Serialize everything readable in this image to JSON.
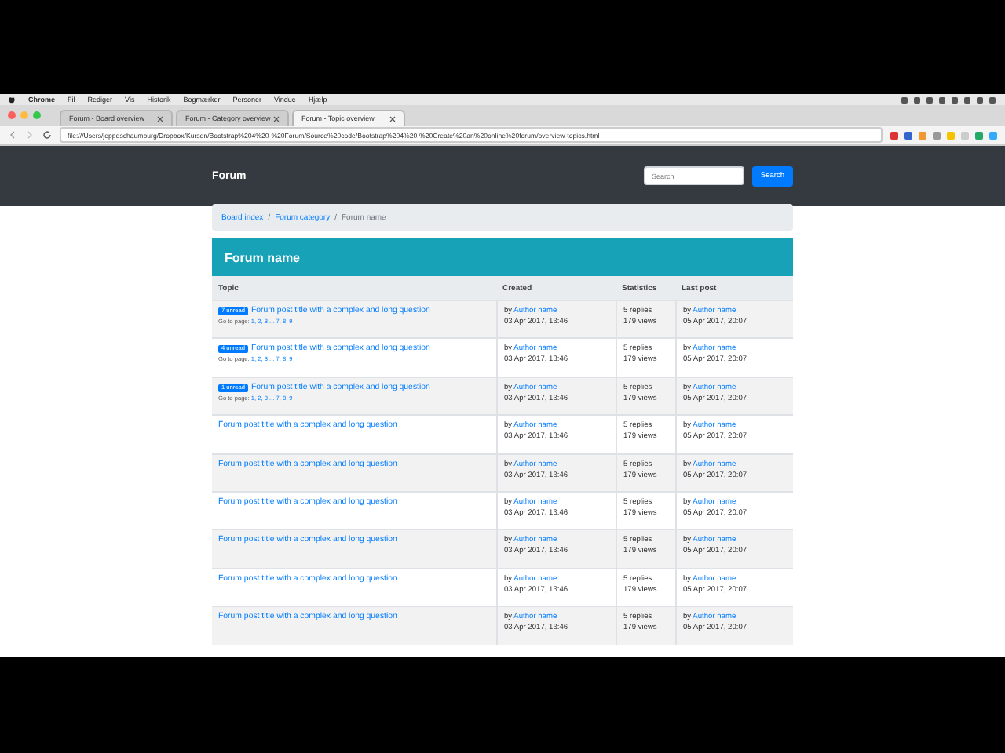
{
  "menu_bar": {
    "items": [
      "Chrome",
      "Fil",
      "Rediger",
      "Vis",
      "Historik",
      "Bogmærker",
      "Personer",
      "Vindue",
      "Hjælp"
    ]
  },
  "tabs": [
    {
      "label": "Forum - Board overview",
      "selected": false
    },
    {
      "label": "Forum - Category overview",
      "selected": false
    },
    {
      "label": "Forum - Topic overview",
      "selected": true
    }
  ],
  "address_bar": {
    "value": "file:///Users/jeppeschaumburg/Dropbox/Kursen/Bootstrap%204%20-%20Forum/Source%20code/Bootstrap%204%20-%20Create%20an%20online%20forum/overview-topics.html"
  },
  "navbar": {
    "brand": "Forum",
    "search": {
      "placeholder": "Search"
    },
    "search_button": "Search"
  },
  "breadcrumb_separator": "/",
  "breadcrumb": [
    {
      "label": "Board index",
      "kind": "link"
    },
    {
      "label": "Forum category",
      "kind": "link"
    },
    {
      "label": "Forum name",
      "kind": "current"
    }
  ],
  "forum": {
    "title": "Forum name",
    "columns": [
      "Topic",
      "Created",
      "Statistics",
      "Last post"
    ],
    "rows": [
      {
        "badge": "7 unread",
        "title": "Forum post title with a complex and long question",
        "pages_label": "Go to page:",
        "pages": "1, 2, 3 ... 7, 8, 9",
        "by": "by",
        "author": "Author name",
        "created": "03 Apr 2017, 13:46",
        "replies": "5 replies",
        "views": "179 views",
        "last_by": "by",
        "last_author": "Author name",
        "last_date": "05 Apr 2017, 20:07"
      },
      {
        "badge": "4 unread",
        "title": "Forum post title with a complex and long question",
        "pages_label": "Go to page:",
        "pages": "1, 2, 3 ... 7, 8, 9",
        "by": "by",
        "author": "Author name",
        "created": "03 Apr 2017, 13:46",
        "replies": "5 replies",
        "views": "179 views",
        "last_by": "by",
        "last_author": "Author name",
        "last_date": "05 Apr 2017, 20:07"
      },
      {
        "badge": "1 unread",
        "title": "Forum post title with a complex and long question",
        "pages_label": "Go to page:",
        "pages": "1, 2, 3 ... 7, 8, 9",
        "by": "by",
        "author": "Author name",
        "created": "03 Apr 2017, 13:46",
        "replies": "5 replies",
        "views": "179 views",
        "last_by": "by",
        "last_author": "Author name",
        "last_date": "05 Apr 2017, 20:07"
      },
      {
        "title": "Forum post title with a complex and long question",
        "by": "by",
        "author": "Author name",
        "created": "03 Apr 2017, 13:46",
        "replies": "5 replies",
        "views": "179 views",
        "last_by": "by",
        "last_author": "Author name",
        "last_date": "05 Apr 2017, 20:07"
      },
      {
        "title": "Forum post title with a complex and long question",
        "by": "by",
        "author": "Author name",
        "created": "03 Apr 2017, 13:46",
        "replies": "5 replies",
        "views": "179 views",
        "last_by": "by",
        "last_author": "Author name",
        "last_date": "05 Apr 2017, 20:07"
      },
      {
        "title": "Forum post title with a complex and long question",
        "by": "by",
        "author": "Author name",
        "created": "03 Apr 2017, 13:46",
        "replies": "5 replies",
        "views": "179 views",
        "last_by": "by",
        "last_author": "Author name",
        "last_date": "05 Apr 2017, 20:07"
      },
      {
        "title": "Forum post title with a complex and long question",
        "by": "by",
        "author": "Author name",
        "created": "03 Apr 2017, 13:46",
        "replies": "5 replies",
        "views": "179 views",
        "last_by": "by",
        "last_author": "Author name",
        "last_date": "05 Apr 2017, 20:07"
      },
      {
        "title": "Forum post title with a complex and long question",
        "by": "by",
        "author": "Author name",
        "created": "03 Apr 2017, 13:46",
        "replies": "5 replies",
        "views": "179 views",
        "last_by": "by",
        "last_author": "Author name",
        "last_date": "05 Apr 2017, 20:07"
      },
      {
        "title": "Forum post title with a complex and long question",
        "by": "by",
        "author": "Author name",
        "created": "03 Apr 2017, 13:46",
        "replies": "5 replies",
        "views": "179 views",
        "last_by": "by",
        "last_author": "Author name",
        "last_date": "05 Apr 2017, 20:07"
      }
    ]
  }
}
